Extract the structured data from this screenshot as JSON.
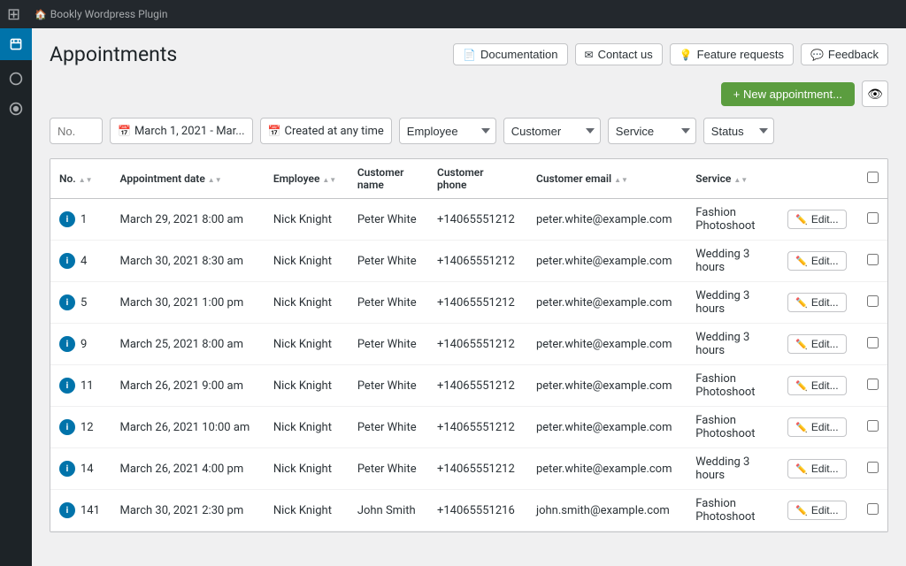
{
  "adminBar": {
    "wpLogo": "⊞",
    "siteItem": "Bookly Wordpress Plugin"
  },
  "sidebar": {
    "icons": [
      {
        "name": "bookly-icon",
        "symbol": "📅"
      },
      {
        "name": "nav-icon-2",
        "symbol": "◆"
      },
      {
        "name": "nav-icon-3",
        "symbol": "◎"
      }
    ]
  },
  "page": {
    "title": "Appointments"
  },
  "headerButtons": [
    {
      "label": "Documentation",
      "name": "documentation-button",
      "icon": "📄"
    },
    {
      "label": "Contact us",
      "name": "contact-us-button",
      "icon": "✉"
    },
    {
      "label": "Feature requests",
      "name": "feature-requests-button",
      "icon": "💡"
    },
    {
      "label": "Feedback",
      "name": "feedback-button",
      "icon": "💬"
    }
  ],
  "toolbar": {
    "newAppointmentLabel": "+ New appointment...",
    "eyeIcon": "👁"
  },
  "filters": {
    "noPlaceholder": "No.",
    "dateRange": "March 1, 2021 - Mar...",
    "createdAt": "Created at any time",
    "employee": "Employee",
    "customer": "Customer",
    "service": "Service",
    "status": "Status",
    "dateIcon": "📅",
    "calendarIcon": "📅"
  },
  "table": {
    "columns": [
      {
        "label": "No.",
        "name": "col-no"
      },
      {
        "label": "Appointment date",
        "name": "col-date"
      },
      {
        "label": "Employee",
        "name": "col-employee"
      },
      {
        "label": "Customer name",
        "name": "col-customer-name"
      },
      {
        "label": "Customer phone",
        "name": "col-customer-phone"
      },
      {
        "label": "Customer email",
        "name": "col-customer-email"
      },
      {
        "label": "Service",
        "name": "col-service"
      }
    ],
    "rows": [
      {
        "id": 1,
        "no": "1",
        "date": "March 29, 2021 8:00 am",
        "employee": "Nick Knight",
        "customerName": "Peter White",
        "customerPhone": "+14065551212",
        "customerEmail": "peter.white@example.com",
        "service": "Fashion Photoshoot"
      },
      {
        "id": 4,
        "no": "4",
        "date": "March 30, 2021 8:30 am",
        "employee": "Nick Knight",
        "customerName": "Peter White",
        "customerPhone": "+14065551212",
        "customerEmail": "peter.white@example.com",
        "service": "Wedding 3 hours"
      },
      {
        "id": 5,
        "no": "5",
        "date": "March 30, 2021 1:00 pm",
        "employee": "Nick Knight",
        "customerName": "Peter White",
        "customerPhone": "+14065551212",
        "customerEmail": "peter.white@example.com",
        "service": "Wedding 3 hours"
      },
      {
        "id": 9,
        "no": "9",
        "date": "March 25, 2021 8:00 am",
        "employee": "Nick Knight",
        "customerName": "Peter White",
        "customerPhone": "+14065551212",
        "customerEmail": "peter.white@example.com",
        "service": "Wedding 3 hours"
      },
      {
        "id": 11,
        "no": "11",
        "date": "March 26, 2021 9:00 am",
        "employee": "Nick Knight",
        "customerName": "Peter White",
        "customerPhone": "+14065551212",
        "customerEmail": "peter.white@example.com",
        "service": "Fashion Photoshoot"
      },
      {
        "id": 12,
        "no": "12",
        "date": "March 26, 2021 10:00 am",
        "employee": "Nick Knight",
        "customerName": "Peter White",
        "customerPhone": "+14065551212",
        "customerEmail": "peter.white@example.com",
        "service": "Fashion Photoshoot"
      },
      {
        "id": 14,
        "no": "14",
        "date": "March 26, 2021 4:00 pm",
        "employee": "Nick Knight",
        "customerName": "Peter White",
        "customerPhone": "+14065551212",
        "customerEmail": "peter.white@example.com",
        "service": "Wedding 3 hours"
      },
      {
        "id": 141,
        "no": "141",
        "date": "March 30, 2021 2:30 pm",
        "employee": "Nick Knight",
        "customerName": "John Smith",
        "customerPhone": "+14065551216",
        "customerEmail": "john.smith@example.com",
        "service": "Fashion Photoshoot"
      }
    ],
    "editLabel": "Edit..."
  }
}
